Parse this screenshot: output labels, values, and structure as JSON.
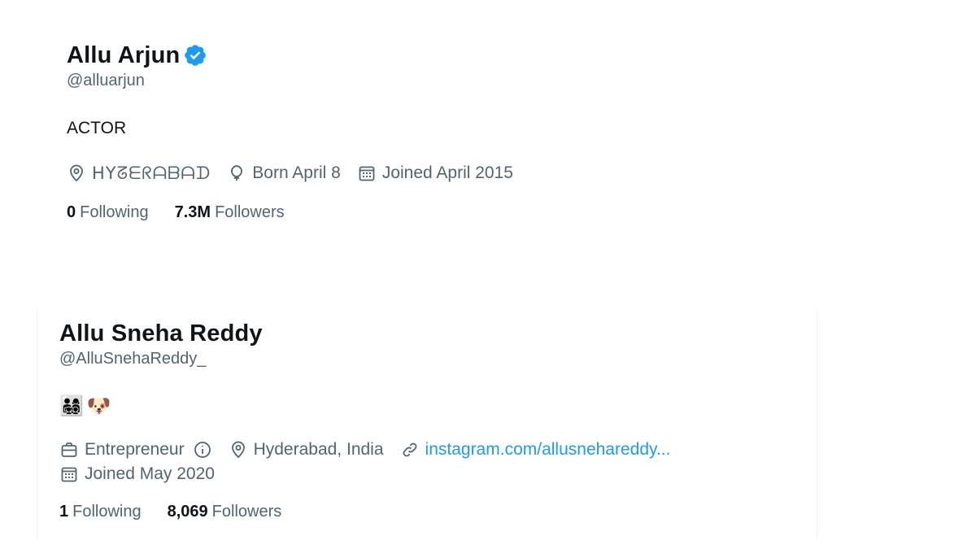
{
  "profile_1": {
    "display_name": "Allu Arjun",
    "verified": true,
    "handle": "@alluarjun",
    "bio": "ACTOR",
    "location": "ᕼYᘔᗴᖇᗩᗷᗩᗪ",
    "birthday": "Born April 8",
    "joined": "Joined April 2015",
    "following_count": "0",
    "following_label": "Following",
    "followers_count": "7.3M",
    "followers_label": "Followers"
  },
  "profile_2": {
    "display_name": "Allu Sneha Reddy",
    "handle": "@AlluSnehaReddy_",
    "bio_emojis": [
      "👨‍👩‍👧‍👦",
      "🐶"
    ],
    "profession": "Entrepreneur",
    "location": "Hyderabad, India",
    "website": "instagram.com/allusnehareddy...",
    "joined": "Joined May 2020",
    "following_count": "1",
    "following_label": "Following",
    "followers_count": "8,069",
    "followers_label": "Followers"
  },
  "colors": {
    "text_primary": "#0f1419",
    "text_secondary": "#536471",
    "link": "#1d9bf0",
    "verified_badge": "#1d9bf0"
  },
  "icons": {
    "location": "map-pin-icon",
    "birthday": "balloon-icon",
    "joined": "calendar-icon",
    "profession": "briefcase-icon",
    "info": "info-icon",
    "website": "link-icon",
    "verified": "verified-badge-icon"
  }
}
